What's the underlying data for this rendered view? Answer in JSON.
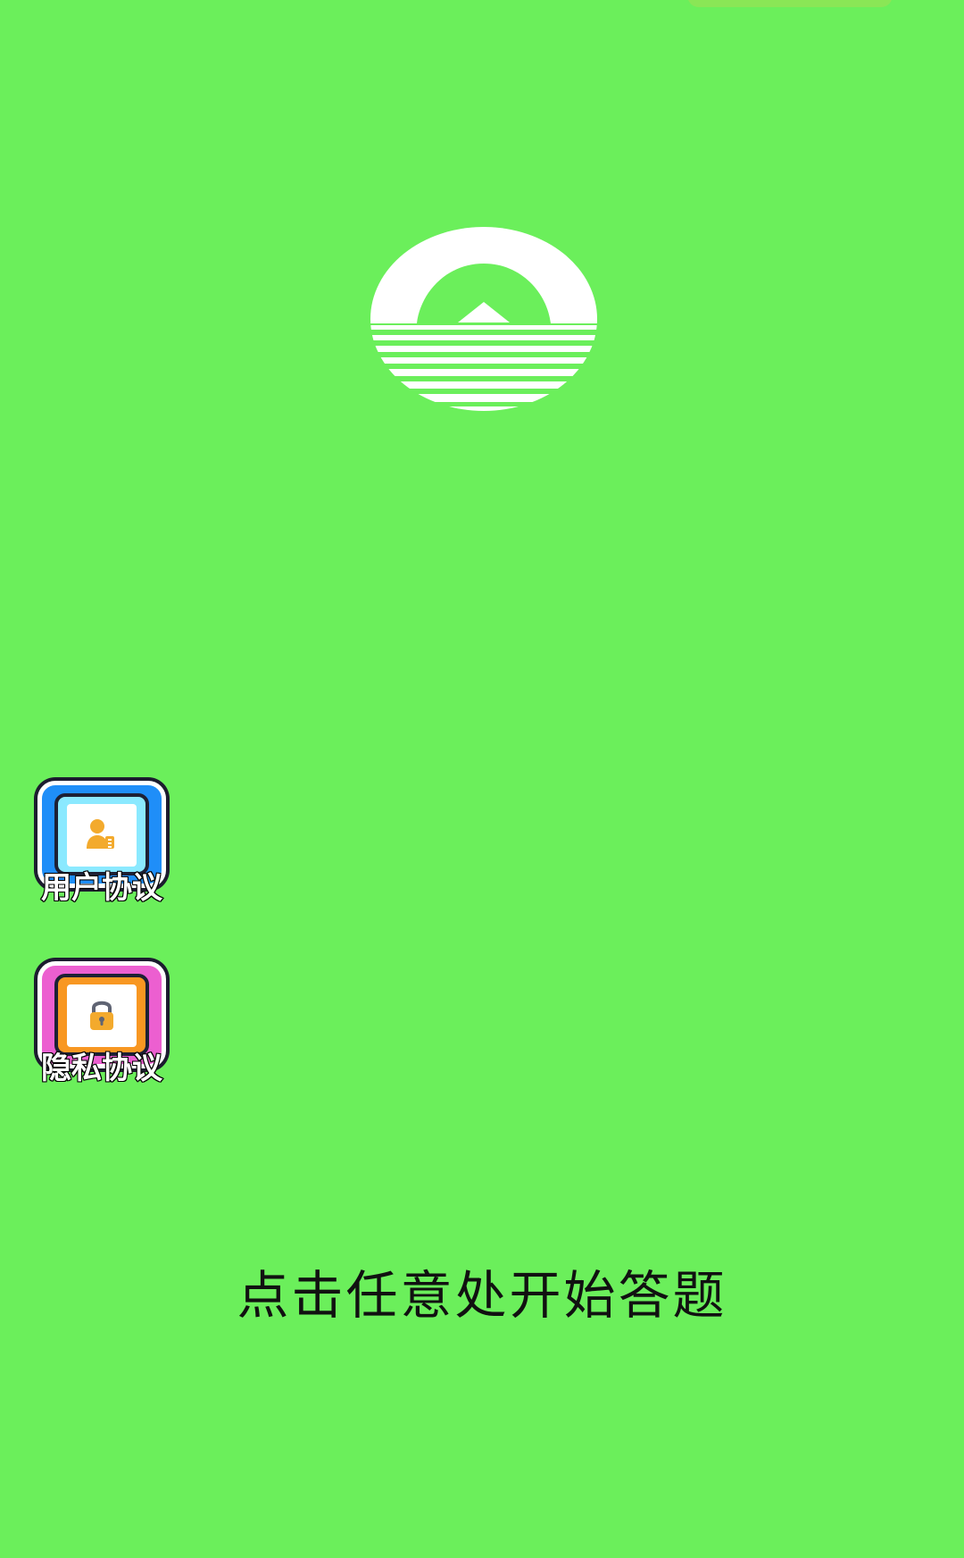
{
  "app": {
    "theme_color": "#6bef5b",
    "logo_icon": "sun-over-water-logo-icon"
  },
  "side_buttons": [
    {
      "label": "用户协议",
      "icon": "person-document-icon",
      "colors": {
        "outer": "#1f8ef8",
        "inner": "#8be9ff",
        "icon": "#f3aa2d"
      }
    },
    {
      "label": "隐私协议",
      "icon": "lock-icon",
      "colors": {
        "outer": "#ec5fd0",
        "inner": "#f89722",
        "icon": "#f3aa2d"
      }
    }
  ],
  "main": {
    "start_prompt": "点击任意处开始答题"
  }
}
